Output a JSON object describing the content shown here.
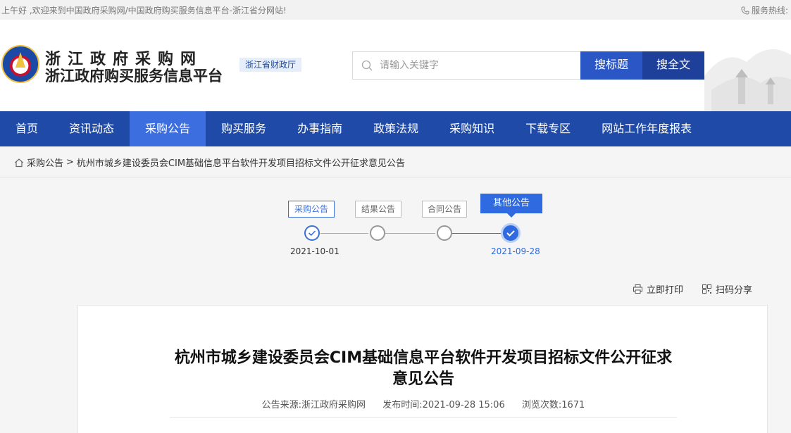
{
  "topbar": {
    "welcome": "上午好 ,欢迎来到中国政府采购网/中国政府购买服务信息平台-浙江省分网站!",
    "hotline": "服务热线:"
  },
  "header": {
    "title_line1": "浙江政府采购网",
    "title_line2": "浙江政府购买服务信息平台",
    "dept": "浙江省财政厅",
    "search_placeholder": "请输入关键字",
    "btn_title": "搜标题",
    "btn_full": "搜全文"
  },
  "nav": {
    "items": [
      "首页",
      "资讯动态",
      "采购公告",
      "购买服务",
      "办事指南",
      "政策法规",
      "采购知识",
      "下载专区",
      "网站工作年度报表"
    ],
    "active": "采购公告"
  },
  "breadcrumb": {
    "parent": "采购公告",
    "separator": ">",
    "current": "杭州市城乡建设委员会CIM基础信息平台软件开发项目招标文件公开征求意见公告"
  },
  "steps": {
    "tags": [
      "采购公告",
      "结果公告",
      "合同公告",
      "其他公告"
    ],
    "date_first": "2021-10-01",
    "date_last": "2021-09-28"
  },
  "tools": {
    "print": "立即打印",
    "share": "扫码分享"
  },
  "article": {
    "title": "杭州市城乡建设委员会CIM基础信息平台软件开发项目招标文件公开征求意见公告",
    "source": "公告来源:浙江政府采购网",
    "published": "发布时间:2021-09-28 15:06",
    "views": "浏览次数:1671"
  },
  "colors": {
    "nav": "#1f4aa8",
    "nav_active": "#3d6ee0",
    "accent": "#2f6ae0"
  }
}
